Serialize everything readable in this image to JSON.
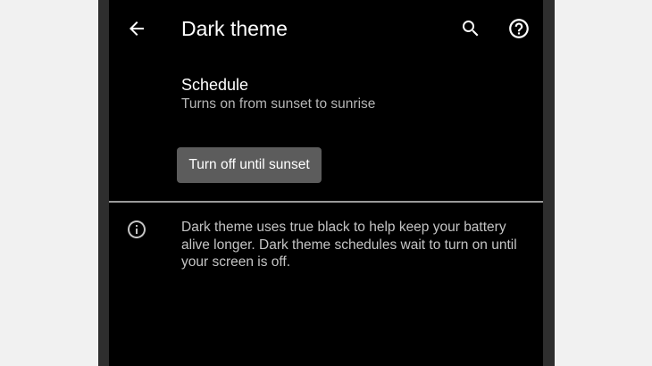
{
  "header": {
    "title": "Dark theme",
    "back_icon": "arrow-back-icon",
    "search_icon": "search-icon",
    "help_icon": "help-icon"
  },
  "schedule": {
    "title": "Schedule",
    "summary": "Turns on from sunset to sunrise"
  },
  "action_button": {
    "label": "Turn off until sunset"
  },
  "footer": {
    "icon": "info-icon",
    "text": "Dark theme uses true black to help keep your battery alive longer. Dark theme schedules wait to turn on until your screen is off."
  },
  "colors": {
    "background": "#000000",
    "primary_text": "#ffffff",
    "secondary_text": "#b6b6b6",
    "button_bg": "#5c5c5c",
    "divider": "#9a9a9a",
    "outer_background": "#f1f1f1",
    "device_frame": "#2e2e2e"
  }
}
